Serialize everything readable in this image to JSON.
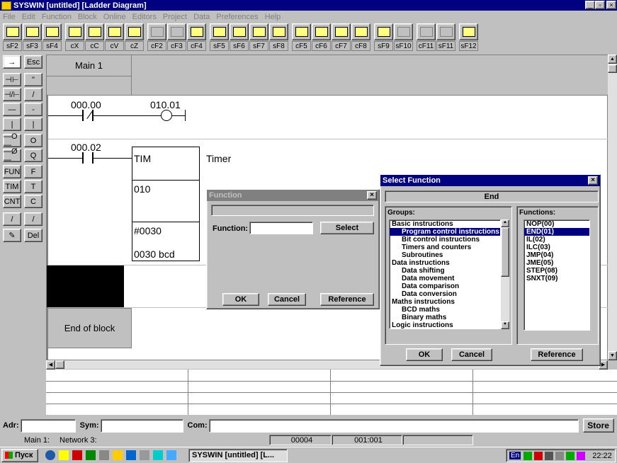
{
  "window": {
    "title": "SYSWIN [untitled] [Ladder Diagram]"
  },
  "menu": [
    "File",
    "Edit",
    "Function",
    "Block",
    "Online",
    "Editors",
    "Project",
    "Data",
    "Preferences",
    "Help"
  ],
  "toolbar_icons": [
    "open-icon",
    "save-icon",
    "print-icon",
    "cut-icon",
    "copy-icon",
    "paste-icon",
    "undo-icon",
    "bits-icon",
    "bits2-icon",
    "block-icon",
    "net-insert-icon",
    "net-goto-icon",
    "net-up-icon",
    "net-check-icon",
    "ladder-icon",
    "io-table-icon",
    "pc-setup-icon",
    "lo-out-icon",
    "monitor-icon",
    "transfer-icon",
    "online-icon",
    "program-icon",
    "mnemonic-icon"
  ],
  "function_keys": [
    "sF2",
    "sF3",
    "sF4",
    "cX",
    "cC",
    "cV",
    "cZ",
    "cF2",
    "cF3",
    "cF4",
    "sF5",
    "sF6",
    "sF7",
    "sF8",
    "cF5",
    "cF6",
    "cF7",
    "cF8",
    "sF9",
    "sF10",
    "cF11",
    "sF11",
    "sF12"
  ],
  "palette": {
    "left": [
      "→",
      "⊣⊢",
      "⊣/⊢",
      "—",
      "|",
      "—O—",
      "—Ø—",
      "FUN",
      "TIM",
      "CNT",
      "/",
      "✎"
    ],
    "right": [
      "Esc",
      "\"",
      "/",
      "-",
      "|",
      "O",
      "Q",
      "F",
      "T",
      "C",
      "/",
      "Del"
    ]
  },
  "ladder": {
    "block_name": "Main 1",
    "rung1": {
      "contact": "000.00",
      "coil": "010.01"
    },
    "rung2": {
      "contact": "000.02",
      "instr": "TIM",
      "comment": "Timer",
      "op1": "010",
      "op2": "#0030",
      "op2_note": "0030 bcd"
    },
    "end_label": "End of block"
  },
  "function_dialog": {
    "title": "Function",
    "field_label": "Function:",
    "field_value": "",
    "select_btn": "Select",
    "ok": "OK",
    "cancel": "Cancel",
    "reference": "Reference"
  },
  "select_dialog": {
    "title": "Select Function",
    "selected_name": "End",
    "groups_label": "Groups:",
    "functions_label": "Functions:",
    "groups": [
      {
        "t": "Basic instructions",
        "sub": false,
        "sel": false
      },
      {
        "t": "Program control instructions",
        "sub": true,
        "sel": true
      },
      {
        "t": "Bit control instructions",
        "sub": true,
        "sel": false
      },
      {
        "t": "Timers and counters",
        "sub": true,
        "sel": false
      },
      {
        "t": "Subroutines",
        "sub": true,
        "sel": false
      },
      {
        "t": "Data instructions",
        "sub": false,
        "sel": false
      },
      {
        "t": "Data shifting",
        "sub": true,
        "sel": false
      },
      {
        "t": "Data movement",
        "sub": true,
        "sel": false
      },
      {
        "t": "Data comparison",
        "sub": true,
        "sel": false
      },
      {
        "t": "Data conversion",
        "sub": true,
        "sel": false
      },
      {
        "t": "Maths instructions",
        "sub": false,
        "sel": false
      },
      {
        "t": "BCD maths",
        "sub": true,
        "sel": false
      },
      {
        "t": "Binary maths",
        "sub": true,
        "sel": false
      },
      {
        "t": "Logic instructions",
        "sub": false,
        "sel": false
      }
    ],
    "functions": [
      {
        "t": "NOP(00)",
        "sel": false
      },
      {
        "t": "END(01)",
        "sel": true
      },
      {
        "t": "IL(02)",
        "sel": false
      },
      {
        "t": "ILC(03)",
        "sel": false
      },
      {
        "t": "JMP(04)",
        "sel": false
      },
      {
        "t": "JME(05)",
        "sel": false
      },
      {
        "t": "STEP(08)",
        "sel": false
      },
      {
        "t": "SNXT(09)",
        "sel": false
      }
    ],
    "ok": "OK",
    "cancel": "Cancel",
    "reference": "Reference"
  },
  "addressbar": {
    "adr_label": "Adr:",
    "sym_label": "Sym:",
    "com_label": "Com:",
    "store": "Store"
  },
  "status": {
    "block": "Main 1:",
    "network": "Network 3:",
    "address": "00004",
    "position": "001:001"
  },
  "taskbar": {
    "start": "Пуск",
    "task": "SYSWIN [untitled] [L...",
    "clock": "22:22",
    "lang": "En"
  },
  "colors": {
    "titlebar": "#000080",
    "selection": "#000080",
    "cursor_block": "#000000"
  }
}
